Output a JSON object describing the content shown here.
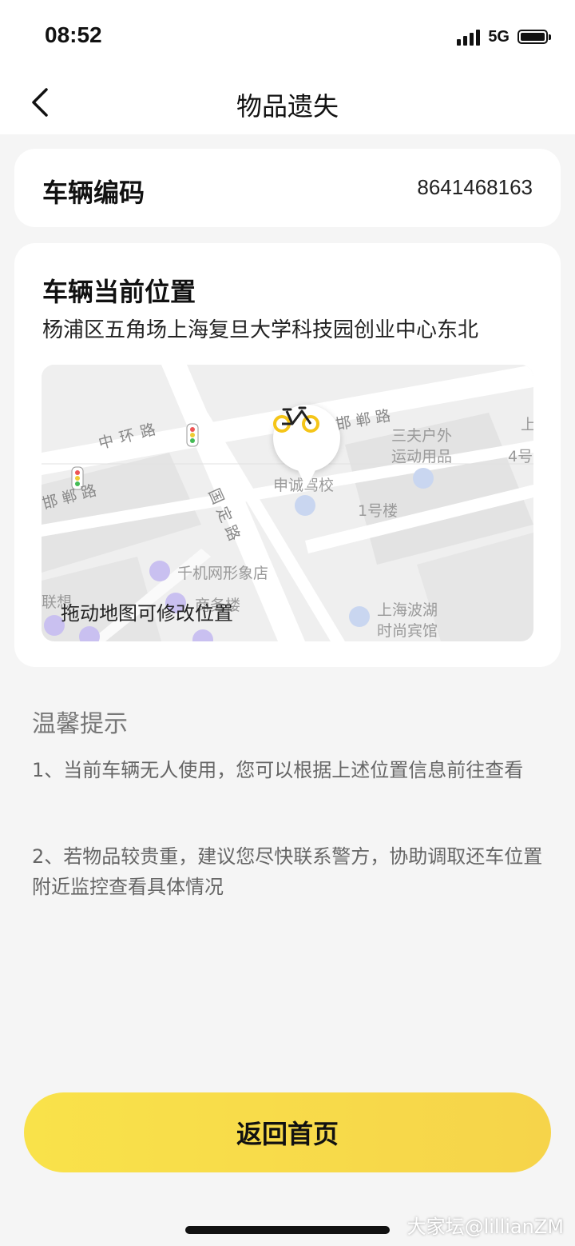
{
  "status_bar": {
    "time": "08:52",
    "network": "5G"
  },
  "nav": {
    "title": "物品遗失"
  },
  "vehicle": {
    "code_label": "车辆编码",
    "code_value": "8641468163"
  },
  "location": {
    "title": "车辆当前位置",
    "address": "杨浦区五角场上海复旦大学科技园创业中心东北",
    "map": {
      "hint": "拖动地图可修改位置",
      "road_labels": [
        "中环路",
        "邯郸路",
        "国定路",
        "邯郸路"
      ],
      "poi_labels": [
        "三夫户外",
        "运动用品",
        "申诚驾校",
        "1号楼",
        "千机网形象店",
        "联想",
        "商务楼",
        "上海波湖",
        "时尚宾馆",
        "4号",
        "上"
      ]
    }
  },
  "tips": {
    "title": "温馨提示",
    "items": [
      "1、当前车辆无人使用，您可以根据上述位置信息前往查看",
      "2、若物品较贵重，建议您尽快联系警方，协助调取还车位置附近监控查看具体情况"
    ]
  },
  "actions": {
    "primary": "返回首页"
  },
  "watermark": "大家坛@lillianZM",
  "colors": {
    "accent": "#f8dc48",
    "background": "#f5f5f5",
    "bike_yellow": "#f5c518"
  }
}
